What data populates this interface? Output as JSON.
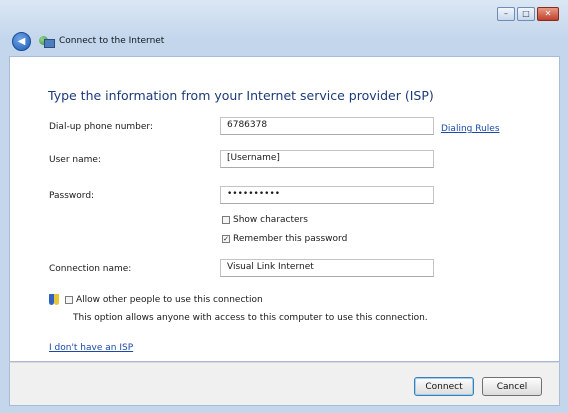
{
  "window": {
    "nav_title": "Connect to the Internet",
    "minimize_label": "–",
    "maximize_label": "□",
    "close_label": "✕"
  },
  "heading": "Type the information from your Internet service provider (ISP)",
  "fields": {
    "dialup_label": "Dial-up phone number:",
    "dialup_value": "6786378",
    "dialing_rules_link": "Dialing Rules",
    "username_label": "User name:",
    "username_value": "[Username]",
    "password_label": "Password:",
    "password_value": "••••••••••",
    "show_characters_label": "Show characters",
    "show_characters_checked": false,
    "remember_password_label": "Remember this password",
    "remember_password_checked": true,
    "connection_name_label": "Connection name:",
    "connection_name_value": "Visual Link Internet"
  },
  "sharing": {
    "allow_label": "Allow other people to use this connection",
    "allow_checked": false,
    "description": "This option allows anyone with access to this computer to use this connection."
  },
  "no_isp_link": "I don't have an ISP",
  "buttons": {
    "connect_label": "Connect",
    "cancel_label": "Cancel"
  },
  "colors": {
    "heading": "#1c3a7a",
    "link": "#1a49a6"
  }
}
